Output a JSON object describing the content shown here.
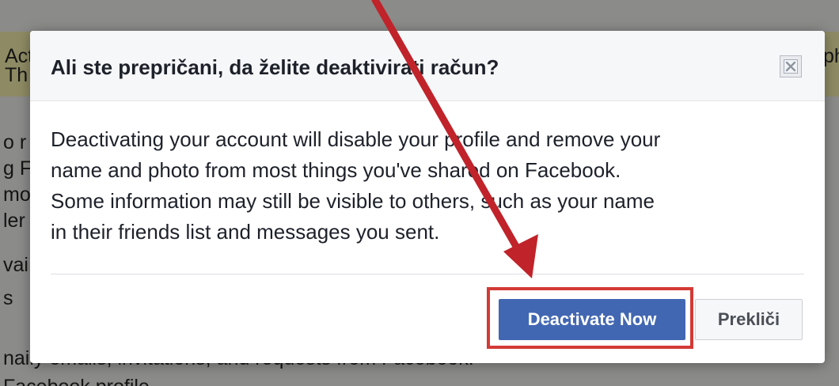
{
  "background": {
    "banner_fragments": [
      "Acti",
      "Th",
      "ph"
    ],
    "left_fragments": [
      "o r",
      "g F",
      "mo",
      "ler",
      "vai",
      "s",
      "naily emails, invitations, and requests from Facebook.",
      "Facebook profile"
    ]
  },
  "dialog": {
    "title": "Ali ste prepričani, da želite deaktivirati račun?",
    "body_lines": [
      "Deactivating your account will disable your profile and remove your",
      "name and photo from most things you've shared on Facebook.",
      "Some information may still be visible to others, such as your name",
      "in their friends list and messages you sent."
    ],
    "primary_button": "Deactivate Now",
    "cancel_button": "Prekliči",
    "close_icon": "close-icon"
  },
  "annotation": {
    "arrow_color": "#c0232a",
    "box_color": "#d33a35"
  },
  "colors": {
    "primary": "#4267b2",
    "header_bg": "#f6f7f9",
    "text": "#1d2129"
  }
}
